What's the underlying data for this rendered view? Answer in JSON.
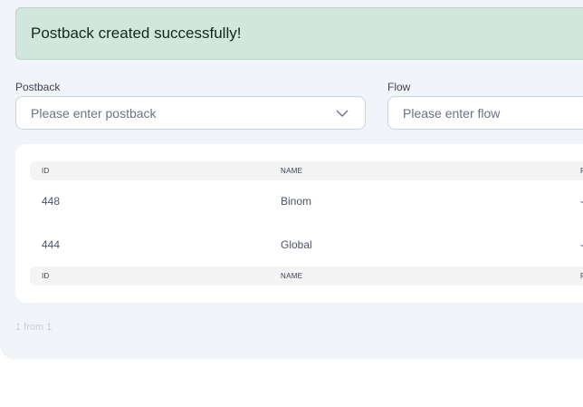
{
  "alert": {
    "message": "Postback created successfully!"
  },
  "filters": {
    "postback": {
      "label": "Postback",
      "placeholder": "Please enter postback"
    },
    "flow": {
      "label": "Flow",
      "placeholder": "Please enter flow"
    }
  },
  "table": {
    "columns": [
      "ID",
      "NAME",
      "F"
    ],
    "rows": [
      {
        "id": "448",
        "name": "Binom",
        "third": "-"
      },
      {
        "id": "444",
        "name": "Global",
        "third": "-"
      }
    ]
  },
  "pagination": {
    "text": "1 from 1"
  },
  "colors": {
    "success_bg": "#d1e7dd",
    "panel_bg": "#f1f5f9"
  }
}
